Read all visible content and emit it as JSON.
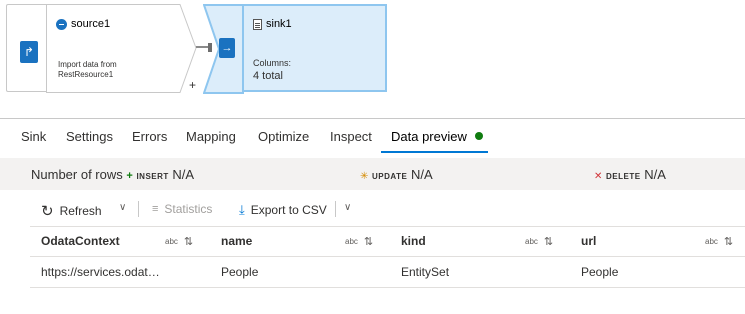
{
  "flow": {
    "source": {
      "title": "source1",
      "description_line1": "Import data from",
      "description_line2": "RestResource1",
      "icon": "rest-source-icon"
    },
    "connector_plus": "+",
    "sink": {
      "title": "sink1",
      "columns_label": "Columns:",
      "columns_value": "4 total",
      "icon": "sink-dataset-icon"
    }
  },
  "tabs": [
    {
      "label": "Sink"
    },
    {
      "label": "Settings"
    },
    {
      "label": "Errors"
    },
    {
      "label": "Mapping"
    },
    {
      "label": "Optimize"
    },
    {
      "label": "Inspect"
    },
    {
      "label": "Data preview",
      "active": true
    }
  ],
  "stats": {
    "rows_label": "Number of rows",
    "insert_key": "INSERT",
    "insert_value": "N/A",
    "update_key": "UPDATE",
    "update_value": "N/A",
    "delete_key": "DELETE",
    "delete_value": "N/A"
  },
  "toolbar": {
    "refresh_label": "Refresh",
    "statistics_label": "Statistics",
    "export_label": "Export to CSV"
  },
  "grid": {
    "type_tag": "abc",
    "columns": [
      "OdataContext",
      "name",
      "kind",
      "url"
    ],
    "rows": [
      [
        "https://services.odat…",
        "People",
        "EntitySet",
        "People"
      ]
    ]
  },
  "colors": {
    "accent": "#0078d4",
    "selection_fill": "#dcedfa",
    "status_green": "#107c10"
  }
}
